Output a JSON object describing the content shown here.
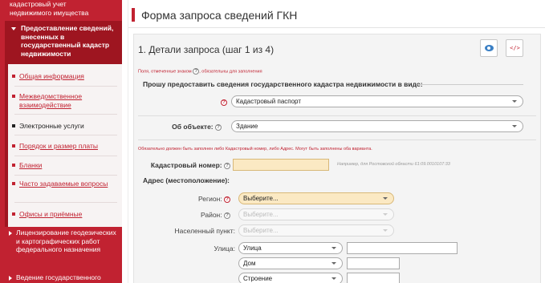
{
  "sidebar": {
    "top_text_line1": "кадастровый учет",
    "top_text_line2": "недвижимого имущества",
    "active_item": "Предоставление сведений, внесенных в государственный кадастр недвижимости",
    "sub_items": [
      {
        "label": "Общая информация"
      },
      {
        "label": "Межведомственное взаимодействие"
      },
      {
        "label": "Электронные услуги"
      },
      {
        "label": "Порядок и размер платы"
      },
      {
        "label": "Бланки"
      },
      {
        "label": "Часто задаваемые вопросы"
      },
      {
        "label": "Офисы и приёмные"
      }
    ],
    "item_licensing": "Лицензирование геодезических и картографических работ федерального назначения",
    "item_maintenance": "Ведение государственного"
  },
  "page": {
    "title": "Форма запроса сведений ГКН",
    "step_title": "1. Детали запроса (шаг 1 из 4)",
    "required_hint_before": "Поля, отмеченные знаком",
    "required_hint_after": ", обязательны для заполнения",
    "question_mark": "?"
  },
  "form": {
    "section_label": "Прошу предоставить сведения государственного кадастра недвижимости в виде:",
    "document_type": {
      "value": "Кадастровый паспорт"
    },
    "object": {
      "label": "Об объекте:",
      "value": "Здание"
    },
    "warning": "Обязательно должен быть заполнен либо Кадастровый номер, либо Адрес. Могут быть заполнены оба варианта.",
    "cadastral_number": {
      "label": "Кадастровый номер:",
      "value": "",
      "example": "Например, для Ростовской области 61:09.0010107:33"
    },
    "address_label": "Адрес (местоположение):",
    "region": {
      "label": "Регион:",
      "value": "Выберите..."
    },
    "district": {
      "label": "Район:",
      "value": "Выберите..."
    },
    "locality": {
      "label": "Населенный пункт:",
      "value": "Выберите..."
    },
    "street": {
      "label": "Улица:",
      "type_value": "Улица",
      "value": ""
    },
    "house": {
      "type_value": "Дом",
      "value": ""
    },
    "building": {
      "type_value": "Строение",
      "value": ""
    }
  },
  "colors": {
    "brand_red": "#c12231",
    "dark_red": "#9e1520",
    "field_yellow": "#fbe9c3"
  },
  "icons": {
    "preview": "eye-icon",
    "xml": "code-icon"
  }
}
